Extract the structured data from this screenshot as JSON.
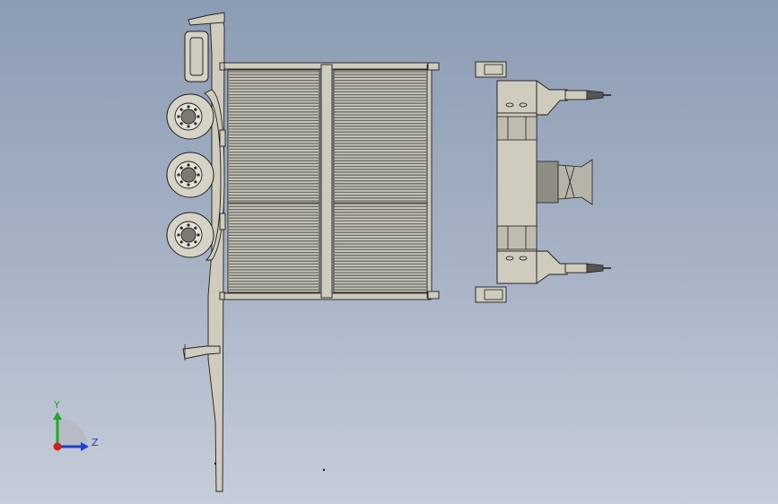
{
  "viewport": {
    "background_top": "#8c9cb3",
    "background_bottom": "#c6cdd9"
  },
  "colors": {
    "part_fill": "#cfcbbd",
    "part_edge": "#1e1e1e",
    "radiator_dark": "#6a6a66",
    "radiator_light": "#c8c5b8",
    "wheel_fill": "#d6d3c6",
    "axis_x": "#d21f1f",
    "axis_y": "#1faa1f",
    "axis_z": "#1f3fd2"
  },
  "triad": {
    "y_label": "Y",
    "z_label": "Z",
    "x_icon": "x-axis-dot-icon"
  }
}
